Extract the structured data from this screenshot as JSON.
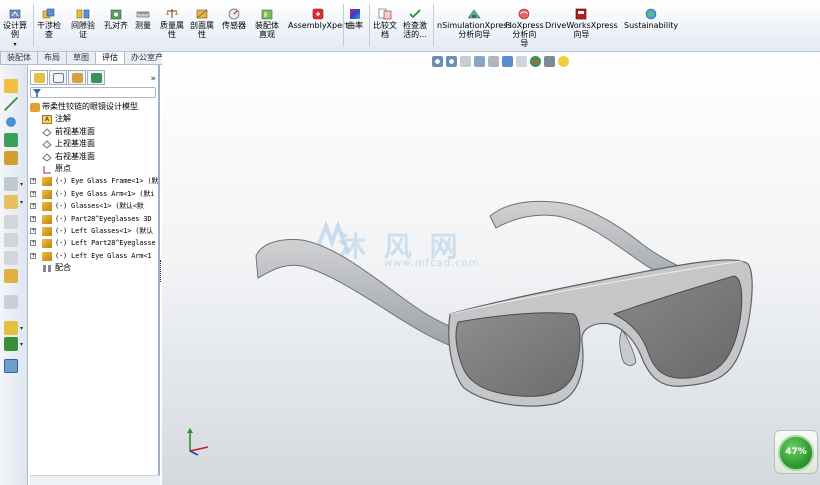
{
  "ribbon": {
    "buttons": [
      {
        "id": "design-study",
        "label": "设计算\n例",
        "icon": "design-study-icon",
        "color": "#4a6fa5"
      },
      {
        "id": "check",
        "label": "干涉检\n查",
        "icon": "interference-icon",
        "color": "#d9a21b"
      },
      {
        "id": "clearance",
        "label": "间隙验\n证",
        "icon": "clearance-icon",
        "color": "#d9a21b"
      },
      {
        "id": "hole",
        "label": "孔对齐",
        "icon": "hole-align-icon",
        "color": "#3c7d3c"
      },
      {
        "id": "measure",
        "label": "测量",
        "icon": "measure-icon",
        "color": "#6a6a6a"
      },
      {
        "id": "mass",
        "label": "质量属\n性",
        "icon": "mass-props-icon",
        "color": "#b5651d"
      },
      {
        "id": "section",
        "label": "剖面属\n性",
        "icon": "section-props-icon",
        "color": "#b5651d"
      },
      {
        "id": "sensor",
        "label": "传感器",
        "icon": "sensor-icon",
        "color": "#a03030"
      },
      {
        "id": "asm-vis",
        "label": "装配体\n直观",
        "icon": "assembly-visual-icon",
        "color": "#2f8f2f"
      },
      {
        "id": "asm-xpert",
        "label": "AssemblyXpert",
        "icon": "assemblyxpert-icon",
        "color": "#c02020"
      },
      {
        "id": "curvature",
        "label": "曲率",
        "icon": "curvature-icon",
        "color": "#7a3fb0"
      },
      {
        "id": "compare",
        "label": "比较文\n档",
        "icon": "compare-docs-icon",
        "color": "#c03030"
      },
      {
        "id": "check-act",
        "label": "检查激\n活的...",
        "icon": "check-active-icon",
        "color": "#3a7d3a"
      },
      {
        "id": "simxpress",
        "label": "nSimulationXpress\n分析向导",
        "icon": "simulationxpress-icon",
        "color": "#2f7f4f"
      },
      {
        "id": "floxpress",
        "label": "FloXpress\n分析向\n导",
        "icon": "floxpress-icon",
        "color": "#d04040"
      },
      {
        "id": "driveworks",
        "label": "DriveWorksXpress\n向导",
        "icon": "driveworksxpress-icon",
        "color": "#a02020"
      },
      {
        "id": "sustain",
        "label": "Sustainability",
        "icon": "sustainability-icon",
        "color": "#3a8fd0"
      }
    ]
  },
  "tabs": [
    {
      "label": "装配体",
      "active": false
    },
    {
      "label": "布局",
      "active": false
    },
    {
      "label": "草图",
      "active": false
    },
    {
      "label": "评估",
      "active": true
    },
    {
      "label": "办公室产品",
      "active": false
    }
  ],
  "tree": {
    "root": "带柔性铰链的眼镜设计模型",
    "items": [
      {
        "label": "注解",
        "icon": "annotation-icon",
        "expandable": false
      },
      {
        "label": "前视基准面",
        "icon": "plane-icon",
        "expandable": false
      },
      {
        "label": "上视基准面",
        "icon": "plane-icon",
        "expandable": false
      },
      {
        "label": "右视基准面",
        "icon": "plane-icon",
        "expandable": false
      },
      {
        "label": "原点",
        "icon": "origin-icon",
        "expandable": false
      },
      {
        "label": "(-) Eye Glass Frame<1> (默",
        "icon": "part-icon",
        "expandable": true,
        "mono": true
      },
      {
        "label": "(-) Eye Glass Arm<1> (默i",
        "icon": "part-icon",
        "expandable": true,
        "mono": true
      },
      {
        "label": "(-) Glasses<1> (默认<默",
        "icon": "part-icon",
        "expandable": true,
        "mono": true
      },
      {
        "label": "(-) Part28^Eyeglasses 3D",
        "icon": "part-icon",
        "expandable": true,
        "mono": true
      },
      {
        "label": "(-) Left Glasses<1> (默认",
        "icon": "part-icon",
        "expandable": true,
        "mono": true
      },
      {
        "label": "(-) Left Part28^Eyeglasse",
        "icon": "part-icon",
        "expandable": true,
        "mono": true
      },
      {
        "label": "(-) Left Eye Glass Arm<1",
        "icon": "part-icon",
        "expandable": true,
        "mono": true
      },
      {
        "label": "配合",
        "icon": "mates-icon",
        "expandable": false
      }
    ]
  },
  "viewport": {
    "watermark_text": "沐 风 网",
    "watermark_url": "www.mfcad.com",
    "progress_percent": "47%",
    "frame_color": "#b9bcbf",
    "lens_color": "#7a7c7e"
  }
}
